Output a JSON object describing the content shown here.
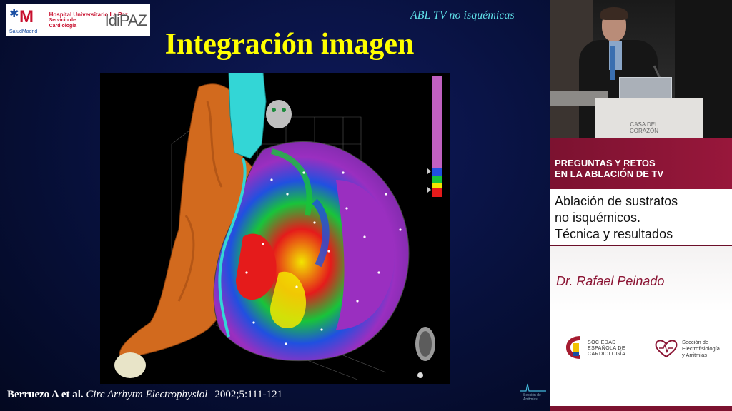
{
  "slide": {
    "logo": {
      "mark_text": "M",
      "sub_text": "SaludMadrid",
      "hospital": "Hospital Universitario La Paz",
      "service": "Servicio de Cardiología",
      "institute": "IdiPAZ"
    },
    "topic": "ABL TV no isquémicas",
    "title": "Integración imagen",
    "citation": {
      "authors": "Berruezo A et al.",
      "journal": "Circ Arrhytm Electrophysiol",
      "ref": "2002;5:111-121"
    },
    "footer_logo_text": "Sección de Arritmias"
  },
  "figure": {
    "colors": {
      "scar_red": "#e51b1b",
      "border_yellow": "#f2e600",
      "healthy_purple": "#9a2fc0",
      "green": "#18c43a",
      "blue": "#2050e0",
      "vessel_orange": "#d26a1e",
      "vessel_cyan": "#33d6d6"
    }
  },
  "video": {
    "lectern_label": "CASA DEL CORAZÓN"
  },
  "info": {
    "header": "Preguntas y retos\nen la ablación de TV",
    "subtitle": "Ablación de sustratos\nno isquémicos.\nTécnica y resultados",
    "speaker": "Dr. Rafael Peinado",
    "society": "Sociedad\nEspañola de\nCardiología",
    "section": "Sección de\nElectrofisiología\ny Arritmias"
  },
  "icons": {
    "heart": "heart-outline-icon",
    "sec_emblem": "sec-shield-icon",
    "madrid_star": "star-icon"
  }
}
